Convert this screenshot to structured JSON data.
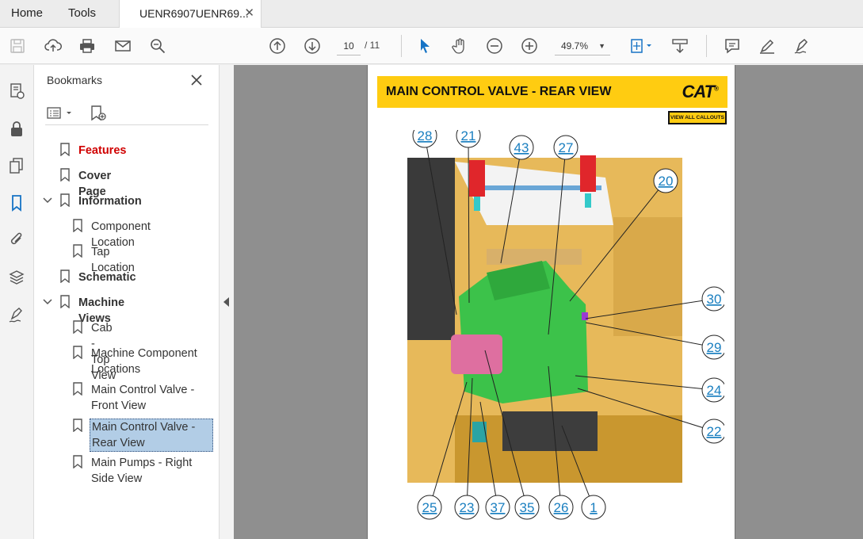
{
  "tabs": {
    "home": "Home",
    "tools": "Tools",
    "document": "UENR6907UENR69...",
    "close": "✕"
  },
  "toolbar": {
    "page_current": "10",
    "page_total": "/ 11",
    "zoom": "49.7%"
  },
  "panel": {
    "title": "Bookmarks",
    "items": [
      {
        "label": "Features"
      },
      {
        "label": "Cover Page"
      },
      {
        "label": "Information"
      },
      {
        "label": "Component Location"
      },
      {
        "label": "Tap Location"
      },
      {
        "label": "Schematic"
      },
      {
        "label": "Machine Views"
      },
      {
        "label": "Cab - Top View"
      },
      {
        "label": "Machine Component Locations"
      },
      {
        "label": "Main Control Valve - Front View"
      },
      {
        "label": "Main Control Valve - Rear View"
      },
      {
        "label": "Main Pumps - Right Side View"
      }
    ]
  },
  "document": {
    "title": "MAIN CONTROL VALVE - REAR VIEW",
    "logo": "CAT",
    "logo_mark": "®",
    "callouts_button": "VIEW ALL CALLOUTS",
    "callouts": [
      "28",
      "21",
      "43",
      "27",
      "20",
      "30",
      "29",
      "24",
      "22",
      "25",
      "23",
      "37",
      "35",
      "26",
      "1"
    ]
  },
  "colors": {
    "banner": "#ffcc11",
    "selected_bookmark": "#b2cde6",
    "features_red": "#d00000",
    "valve_green": "#3cc24a",
    "frame_yellow": "#e6b84a",
    "callout_link": "#1a7fc0"
  }
}
